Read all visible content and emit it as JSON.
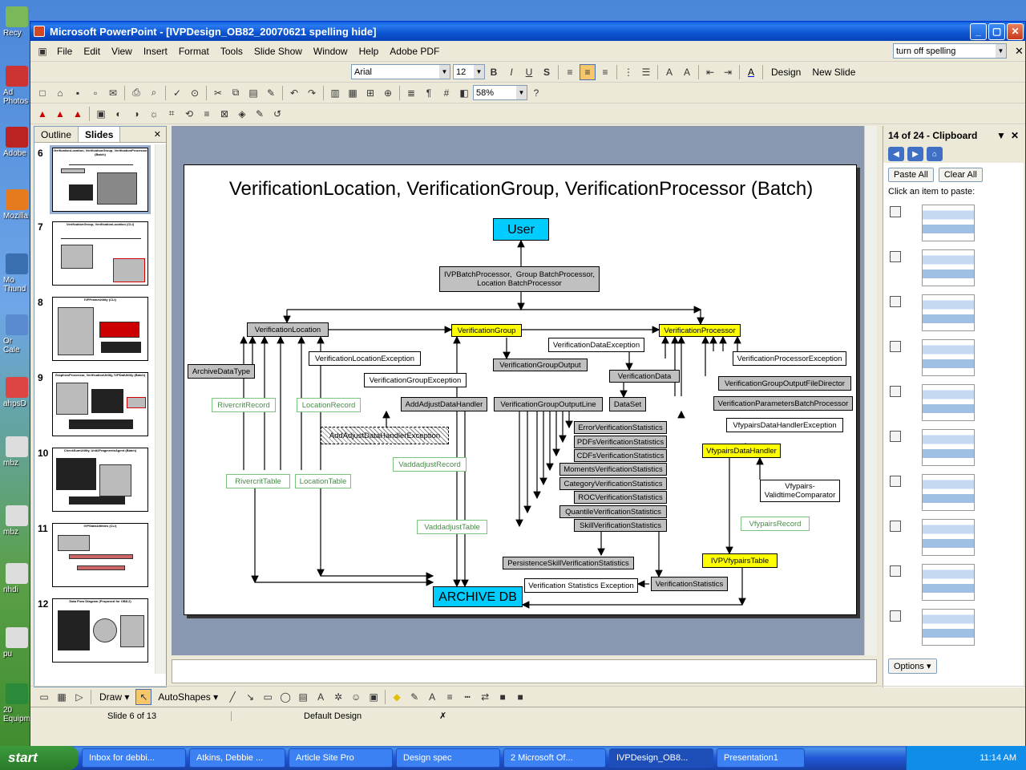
{
  "window": {
    "title": "Microsoft PowerPoint - [IVPDesign_OB82_20070621 spelling hide]"
  },
  "menu": [
    "File",
    "Edit",
    "View",
    "Insert",
    "Format",
    "Tools",
    "Slide Show",
    "Window",
    "Help",
    "Adobe PDF"
  ],
  "help_box": {
    "value": "turn off spelling"
  },
  "formatting": {
    "font": "Arial",
    "size": "12",
    "design_label": "Design",
    "new_slide_label": "New Slide"
  },
  "standard": {
    "zoom": "58%"
  },
  "left_pane": {
    "tabs": [
      "Outline",
      "Slides"
    ],
    "slides": [
      {
        "num": "6",
        "title": "VerificationLocation, VerificationGroup, VerificationProcessor (Batch)"
      },
      {
        "num": "7",
        "title": "VerificationGroup, VerificationLocation (CLI)"
      },
      {
        "num": "8",
        "title": "IVPFrameUtility (CLI)"
      },
      {
        "num": "9",
        "title": "GraphicsProcessor, VerificationUtility, IVPDatUtility (Batch)"
      },
      {
        "num": "10",
        "title": "CheckSumUtility, Unit2FragmentsAgent (Batch)"
      },
      {
        "num": "11",
        "title": "IVPStatsUtilities (CLI)"
      },
      {
        "num": "12",
        "title": "Data Flow Diagram (Proposed for OB8.2)"
      }
    ]
  },
  "slide": {
    "title": "VerificationLocation, VerificationGroup, VerificationProcessor (Batch)",
    "boxes": {
      "user": "User",
      "batch": "IVPBatchProcessor,  Group BatchProcessor,\nLocation BatchProcessor",
      "vloc": "VerificationLocation",
      "vgroup": "VerificationGroup",
      "vproc": "VerificationProcessor",
      "archive_type": "ArchiveDataType",
      "vloc_exc": "VerificationLocationException",
      "vdata_exc": "VerificationDataException",
      "vproc_exc": "VerificationProcessorException",
      "vgroup_exc": "VerificationGroupException",
      "vgroup_out": "VerificationGroupOutput",
      "vdata": "VerificationData",
      "vgo_dir": "VerificationGroupOutputFileDirector",
      "rivercrit_rec": "RivercritRecord",
      "loc_rec": "LocationRecord",
      "add_adjust": "AddAdjustDataHandler",
      "vgo_line": "VerificationGroupOutputLine",
      "dataset": "DataSet",
      "vparam": "VerificationParametersBatchProcessor",
      "aa_exc": "AddAdjustDataHandlerException",
      "vfy_exc": "VfypairsDataHandlerException",
      "err_stats": "ErrorVerificationStatistics",
      "pdf_stats": "PDFsVerificationStatistics",
      "cdf_stats": "CDFsVerificationStatistics",
      "mom_stats": "MomentsVerificationStatistics",
      "cat_stats": "CategoryVerificationStatistics",
      "roc_stats": "ROCVerificationStatistics",
      "quant_stats": "QuantileVerificationStatistics",
      "skill_stats": "SkillVerificationStatistics",
      "vadd_rec": "VaddadjustRecord",
      "vfy_handler": "VfypairsDataHandler",
      "vfy_comp": "Vfypairs-\nValidtimeComparator",
      "riv_table": "RivercritTable",
      "loc_table": "LocationTable",
      "vadd_table": "VaddadjustTable",
      "vfy_rec": "VfypairsRecord",
      "persist": "PersistenceSkillVerificationStatistics",
      "ivp_table": "IVPVfypairsTable",
      "vstats_exc": "Verification Statistics Exception",
      "vstats": "VerificationStatistics",
      "archive": "ARCHIVE DB"
    }
  },
  "clipboard": {
    "title": "14 of 24 - Clipboard",
    "paste_all": "Paste All",
    "clear_all": "Clear All",
    "hint": "Click an item to paste:",
    "options": "Options"
  },
  "draw": {
    "draw_label": "Draw",
    "autoshapes_label": "AutoShapes"
  },
  "status": {
    "slide": "Slide 6 of 13",
    "design": "Default Design"
  },
  "taskbar": {
    "start": "start",
    "tasks": [
      "Inbox for debbi...",
      "Atkins, Debbie ...",
      "Article Site Pro",
      "Design spec",
      "2 Microsoft Of...",
      "IVPDesign_OB8...",
      "Presentation1"
    ],
    "clock": "11:14 AM"
  },
  "desktop_icons": [
    "Recy",
    "Ad Photos",
    "Adobe",
    "Mozilla",
    "Mo Thund",
    "Or Cale",
    "ahpsD",
    "mbz",
    "mbz",
    "nhdi",
    "pu",
    "20 Equipm..."
  ]
}
